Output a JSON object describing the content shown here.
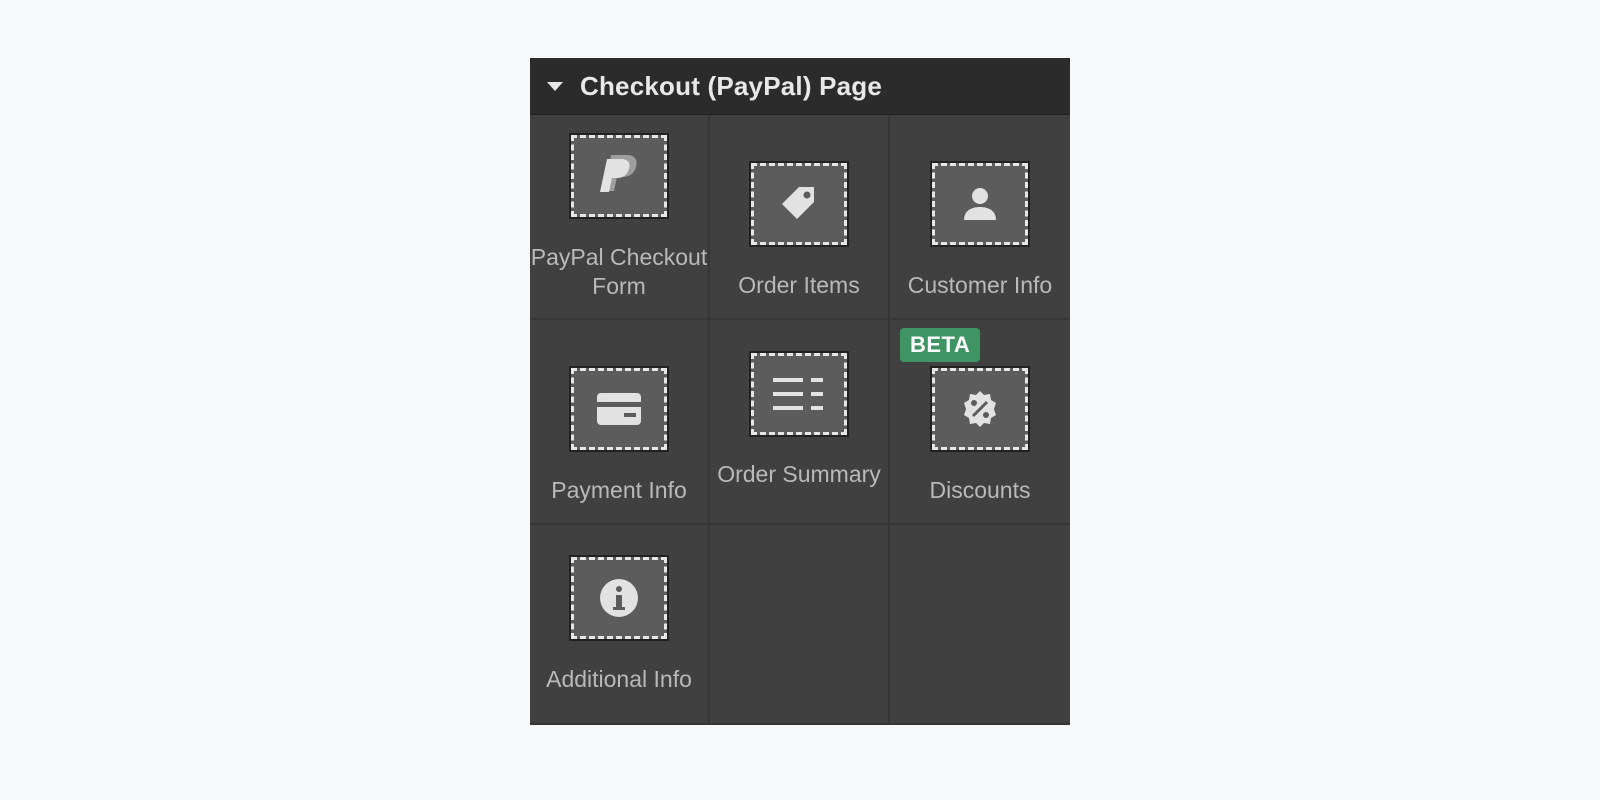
{
  "panel": {
    "title": "Checkout (PayPal) Page"
  },
  "elements": [
    {
      "label": "PayPal Checkout Form",
      "icon": "paypal-icon"
    },
    {
      "label": "Order Items",
      "icon": "tag-icon"
    },
    {
      "label": "Customer Info",
      "icon": "person-icon"
    },
    {
      "label": "Payment Info",
      "icon": "credit-card-icon"
    },
    {
      "label": "Order Summary",
      "icon": "list-icon"
    },
    {
      "label": "Discounts",
      "icon": "discount-icon",
      "badge": "BETA"
    },
    {
      "label": "Additional Info",
      "icon": "info-icon"
    }
  ],
  "colors": {
    "panel_bg": "#404040",
    "header_bg": "#2b2b2b",
    "badge_bg": "#3f9463",
    "label_text": "#b9b9b9"
  }
}
